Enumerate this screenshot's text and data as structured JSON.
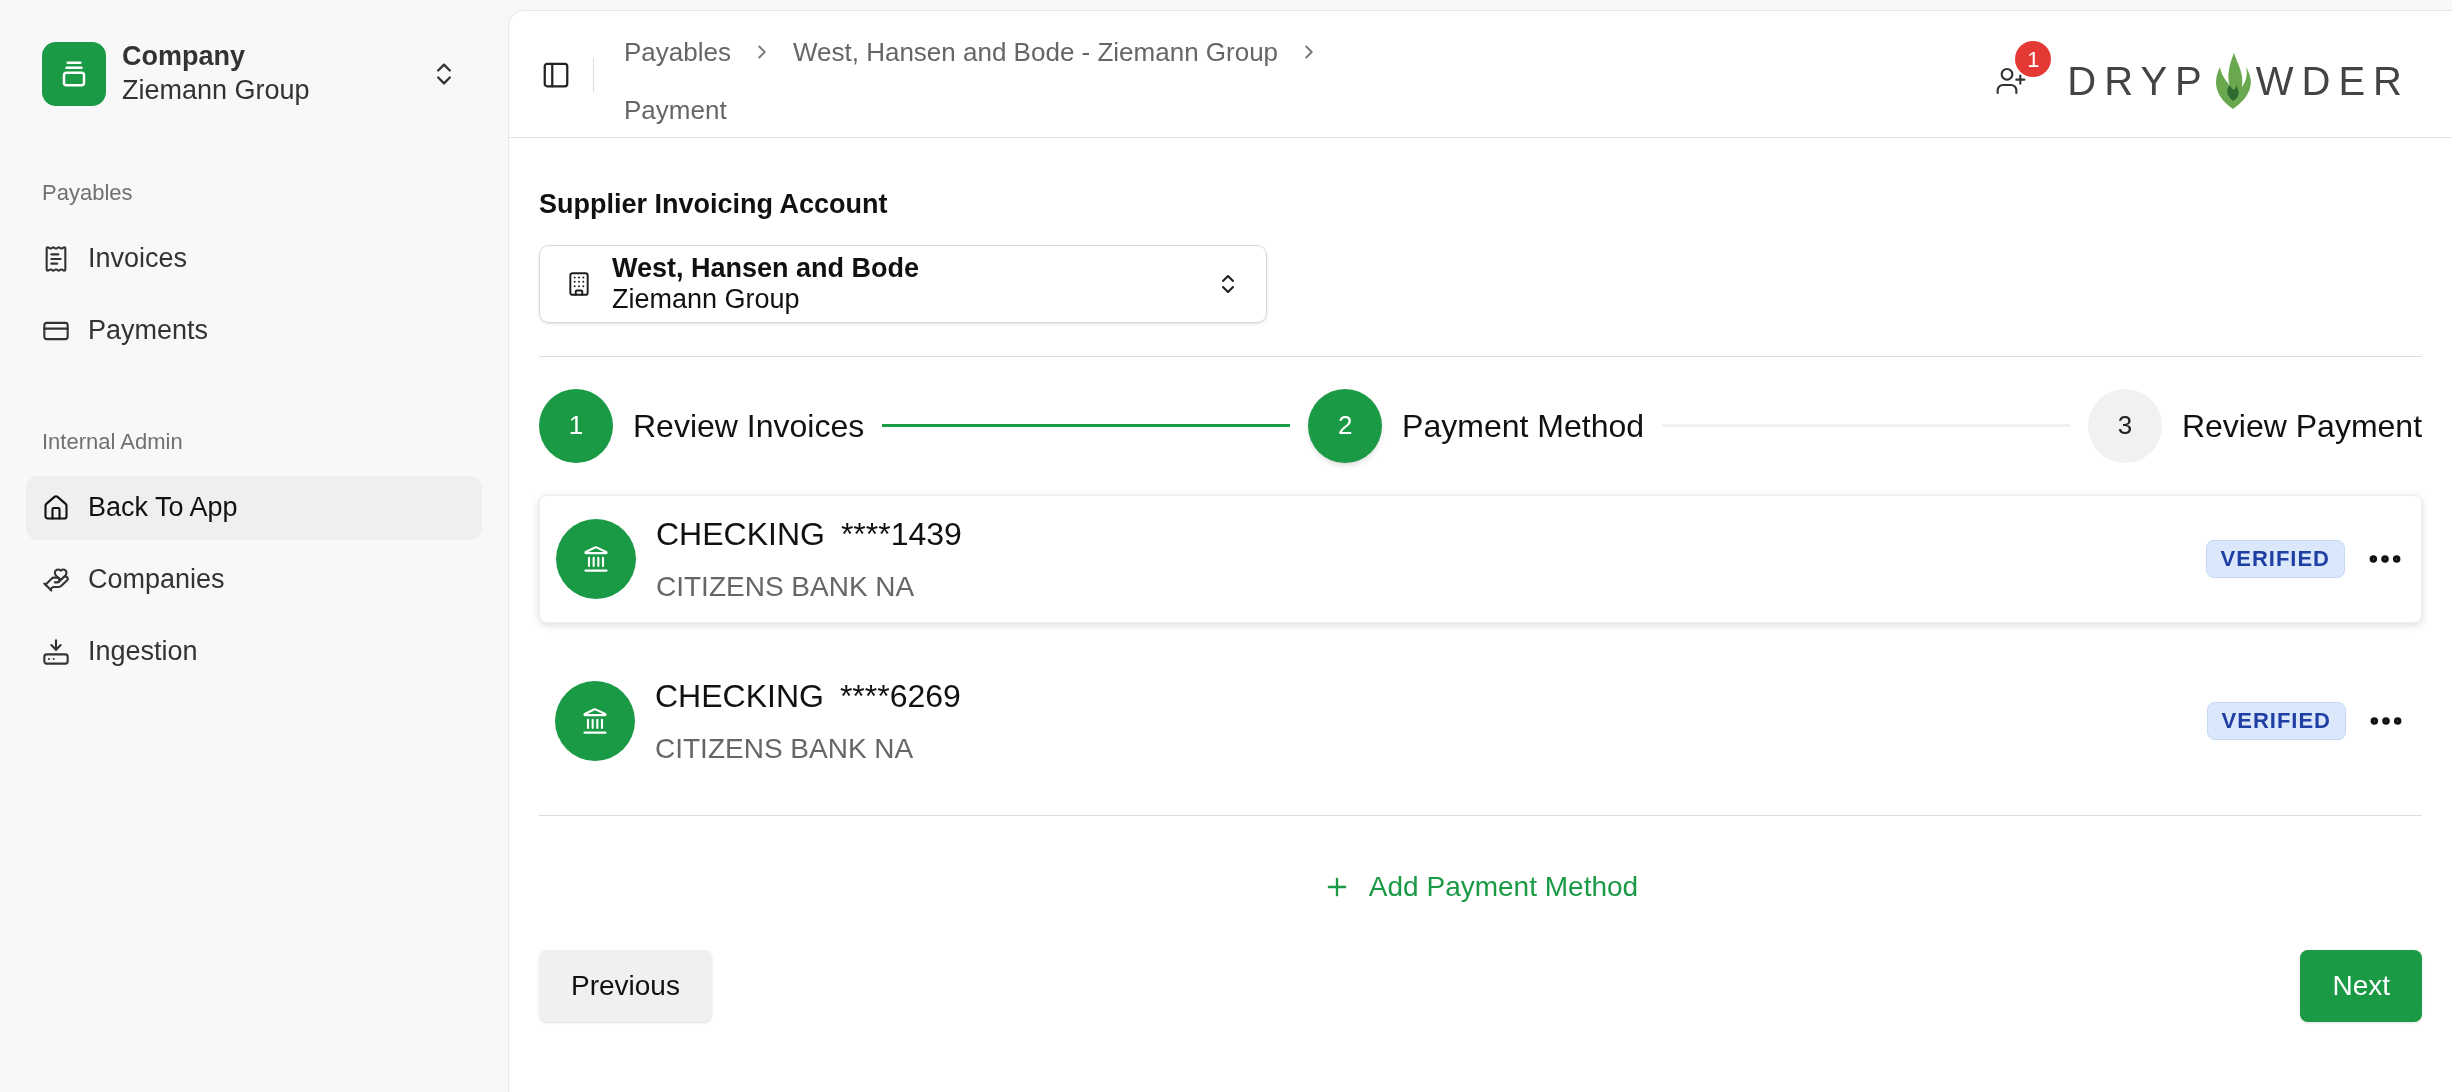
{
  "sidebar": {
    "company": {
      "title": "Company",
      "subtitle": "Ziemann Group"
    },
    "sections": [
      {
        "heading": "Payables",
        "items": [
          {
            "label": "Invoices",
            "selected": false
          },
          {
            "label": "Payments",
            "selected": false
          }
        ]
      },
      {
        "heading": "Internal Admin",
        "items": [
          {
            "label": "Back To App",
            "selected": true
          },
          {
            "label": "Companies",
            "selected": false
          },
          {
            "label": "Ingestion",
            "selected": false
          }
        ]
      }
    ]
  },
  "header": {
    "breadcrumbs": [
      "Payables",
      "West, Hansen and Bode - Ziemann Group",
      "Payment"
    ],
    "notification_count": "1",
    "logo": {
      "text_start": "DRYP",
      "text_end": "WDER"
    }
  },
  "supplier_account": {
    "label": "Supplier Invoicing Account",
    "value_title": "West, Hansen and Bode",
    "value_subtitle": "Ziemann Group"
  },
  "steps": [
    {
      "number": "1",
      "label": "Review Invoices",
      "completed": true,
      "selected": false
    },
    {
      "number": "2",
      "label": "Payment Method",
      "completed": false,
      "selected": true
    },
    {
      "number": "3",
      "label": "Review Payment",
      "completed": false,
      "selected": false
    }
  ],
  "accounts": [
    {
      "type": "CHECKING",
      "number": "****1439",
      "bank": "CITIZENS BANK NA",
      "status": "VERIFIED",
      "selected": true
    },
    {
      "type": "CHECKING",
      "number": "****6269",
      "bank": "CITIZENS BANK NA",
      "status": "VERIFIED",
      "selected": false
    }
  ],
  "add_method": "Add Payment Method",
  "buttons": {
    "previous": "Previous",
    "next": "Next"
  }
}
